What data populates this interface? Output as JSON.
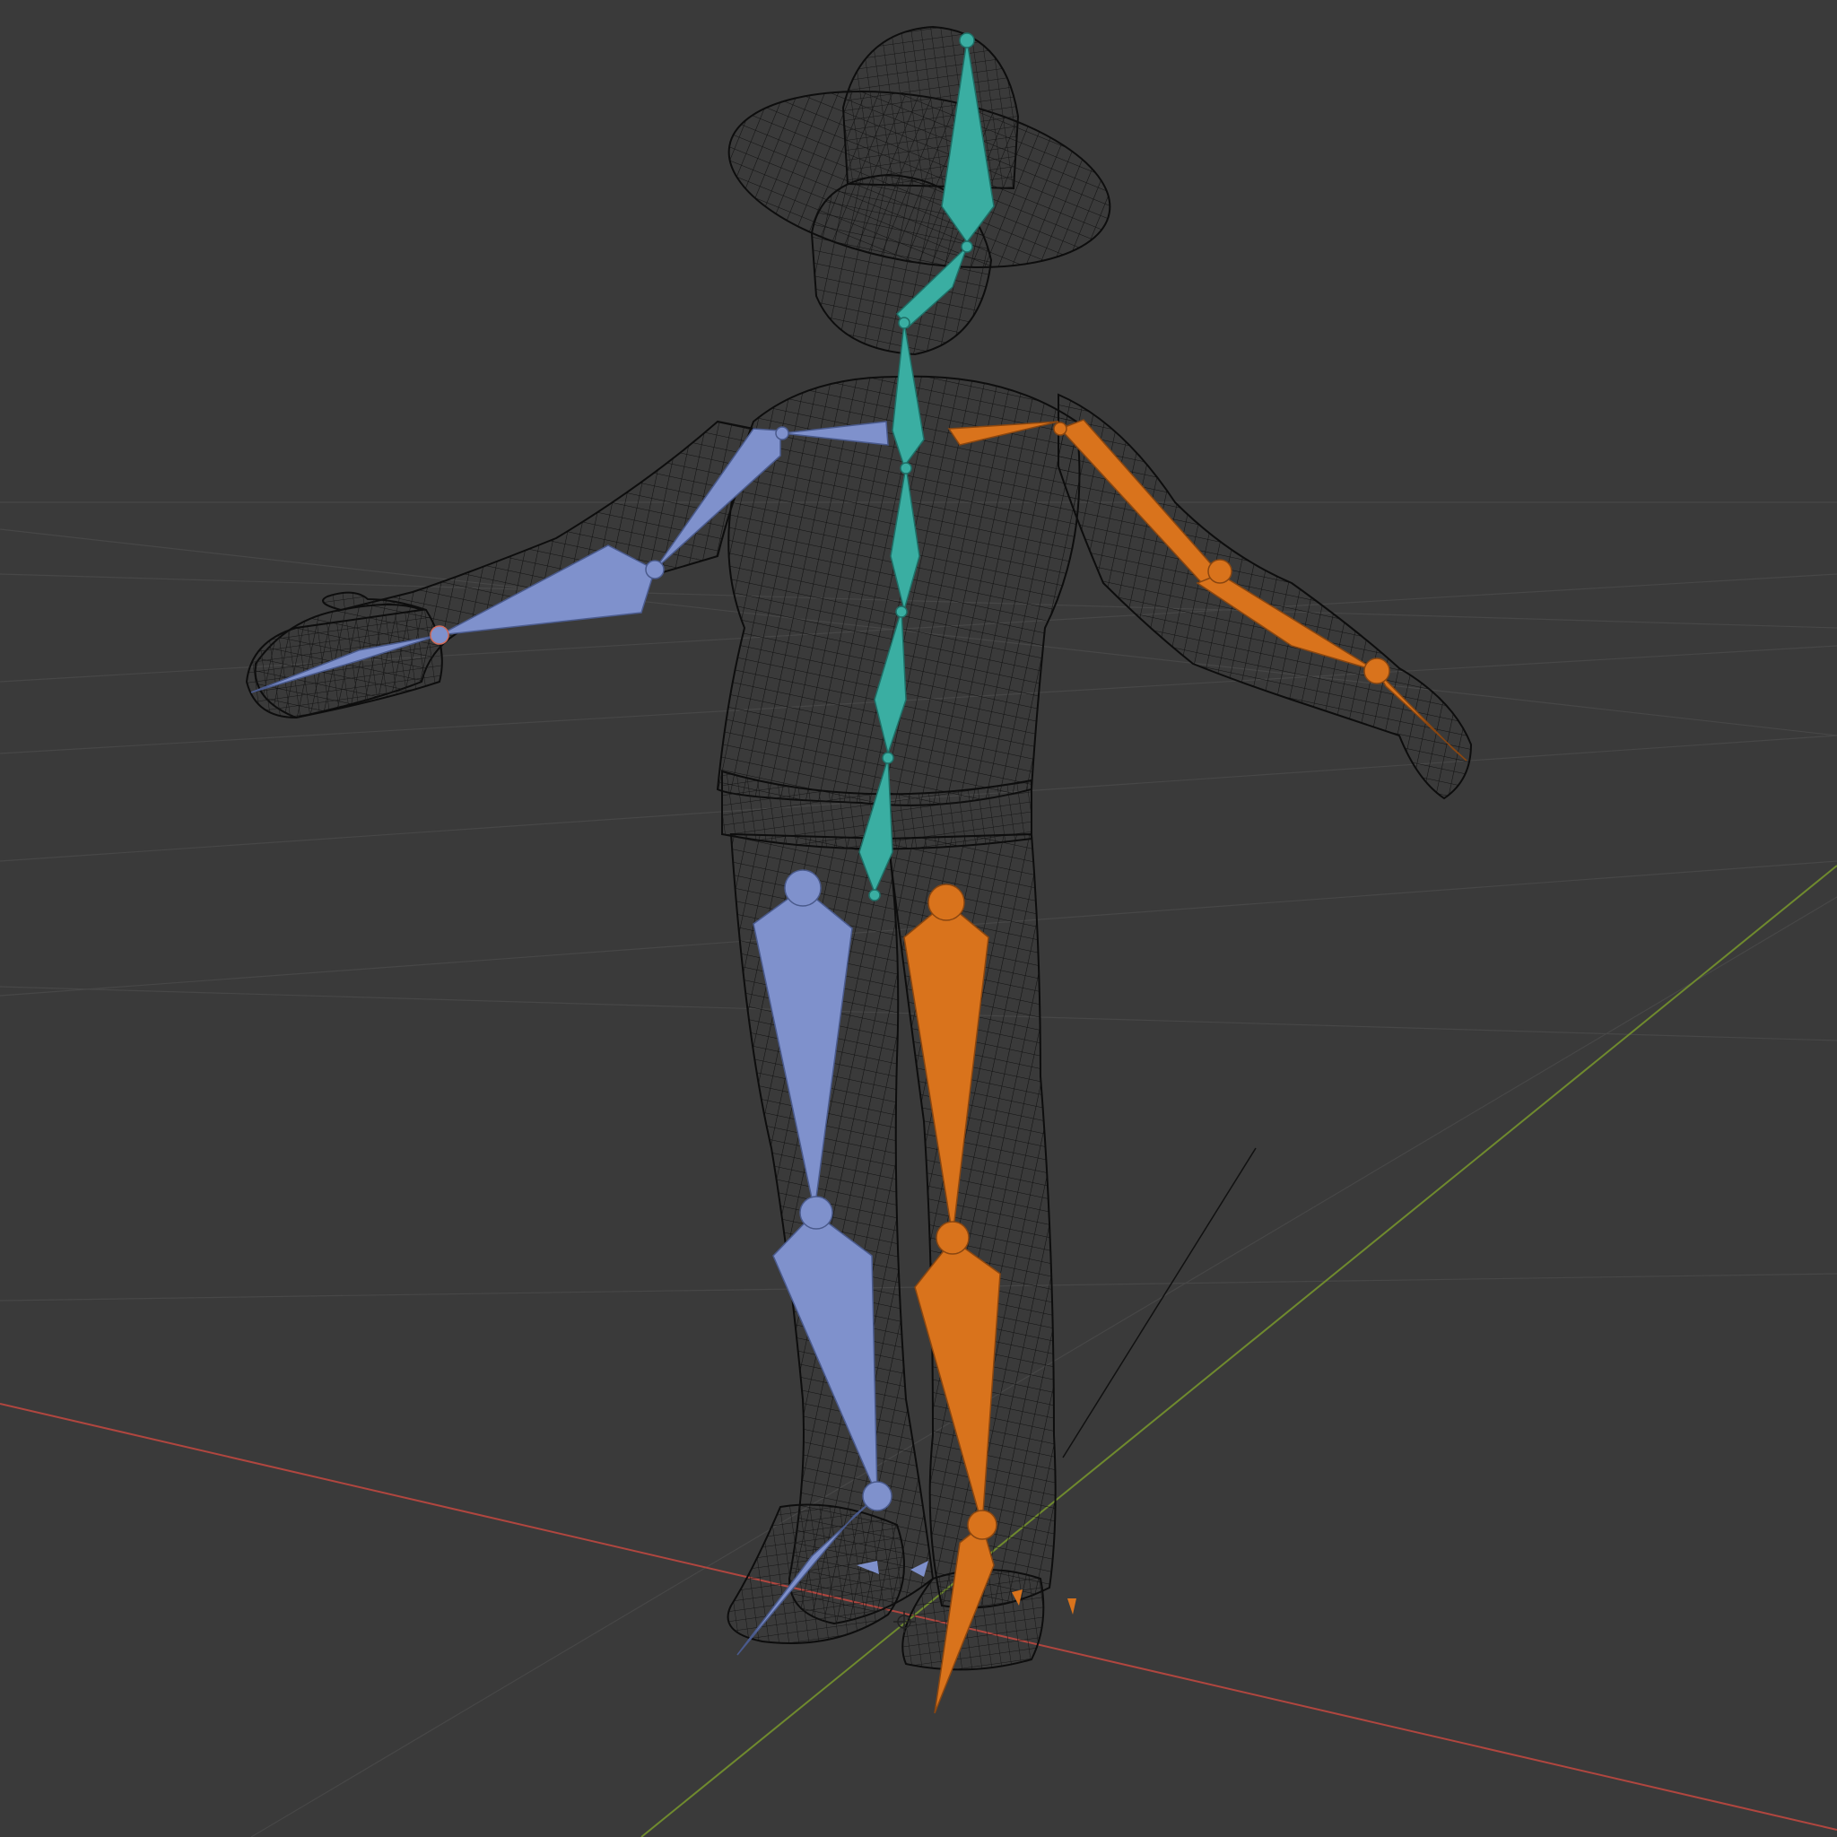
{
  "viewport": {
    "mode": "3D viewport",
    "display": "wireframe",
    "background_color": "#3a3a3a"
  },
  "colors": {
    "grid": "#4a4a4a",
    "x_axis": "#b0463f",
    "y_axis": "#6f8a2e",
    "wire": "#111111",
    "bone_center": "#3aaea2",
    "bone_left": "#7f91cc",
    "bone_right": "#d9731c"
  },
  "scene": {
    "object": "character-mesh",
    "armature": {
      "groups": [
        "spine",
        "left-arm",
        "right-arm",
        "left-leg",
        "right-leg"
      ]
    }
  }
}
